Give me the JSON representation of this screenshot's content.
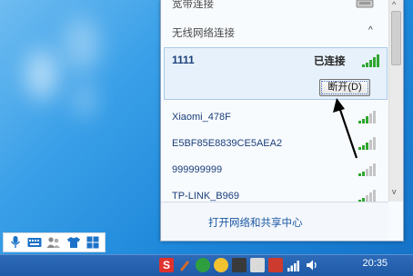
{
  "popup": {
    "broadband": {
      "label": "宽带连接"
    },
    "wireless_section": {
      "label": "无线网络连接",
      "toggle": "^"
    },
    "connected": {
      "ssid": "1111",
      "status": "已连接",
      "disconnect_label": "断开(D)"
    },
    "networks": [
      {
        "ssid": "Xiaomi_478F"
      },
      {
        "ssid": "E5BF85E8839CE5AEA2"
      },
      {
        "ssid": "999999999"
      },
      {
        "ssid": "TP-LINK_B969"
      }
    ],
    "footer_link": "打开网络和共享中心",
    "scroll": {
      "up": "^",
      "down": "v"
    }
  },
  "taskbar": {
    "clock": "20:35"
  },
  "colors": {
    "accent": "#1d5aa5",
    "signal_green": "#2fa62f"
  },
  "icons": [
    "microphone-icon",
    "keyboard-icon",
    "users-icon",
    "shirt-icon",
    "grid-icon",
    "network-icon",
    "volume-icon"
  ]
}
